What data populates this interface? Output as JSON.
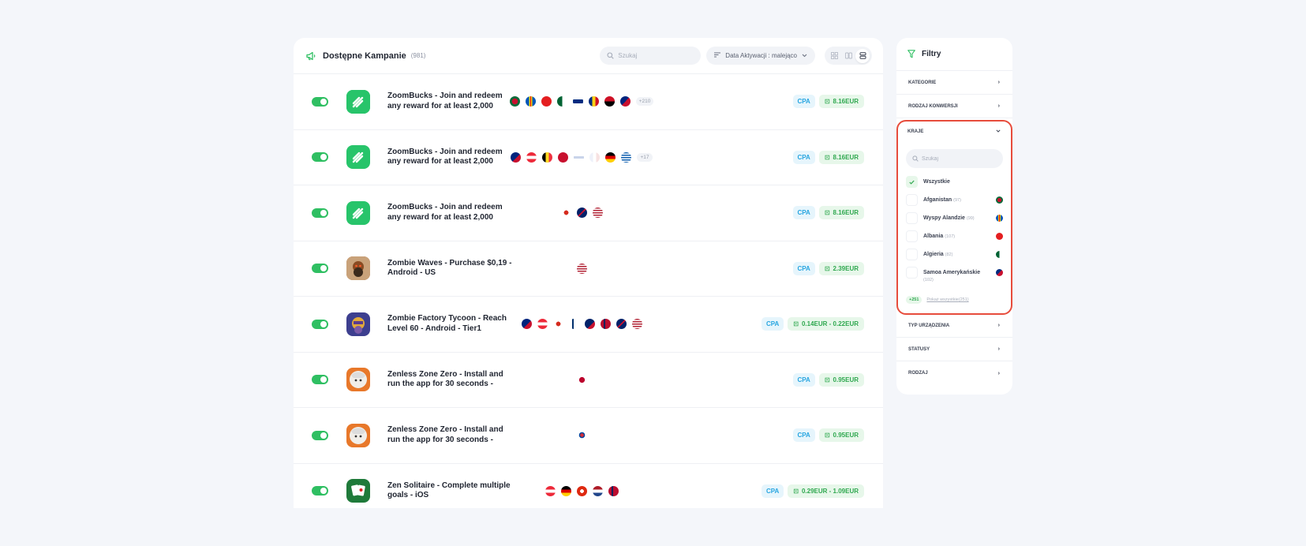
{
  "header": {
    "title": "Dostępne Kampanie",
    "count": "(981)",
    "search_placeholder": "Szukaj",
    "sort_label": "Data Aktywacji : malejąco"
  },
  "campaigns": [
    {
      "title": "ZoomBucks - Join and redeem any reward for at least 2,000",
      "more": "+210",
      "type": "CPA",
      "payout": "8.16EUR"
    },
    {
      "title": "ZoomBucks - Join and redeem any reward for at least 2,000",
      "more": "+17",
      "type": "CPA",
      "payout": "8.16EUR"
    },
    {
      "title": "ZoomBucks - Join and redeem any reward for at least 2,000",
      "more": "",
      "type": "CPA",
      "payout": "8.16EUR"
    },
    {
      "title": "Zombie Waves - Purchase $0,19 - Android - US",
      "more": "",
      "type": "CPA",
      "payout": "2.39EUR"
    },
    {
      "title": "Zombie Factory Tycoon - Reach Level 60 - Android - Tier1",
      "more": "",
      "type": "CPA",
      "payout": "0.14EUR - 0.22EUR"
    },
    {
      "title": "Zenless Zone Zero - Install and run the app for 30 seconds -",
      "more": "",
      "type": "CPA",
      "payout": "0.95EUR"
    },
    {
      "title": "Zenless Zone Zero - Install and run the app for 30 seconds -",
      "more": "",
      "type": "CPA",
      "payout": "0.95EUR"
    },
    {
      "title": "Zen Solitaire - Complete multiple goals - iOS",
      "more": "",
      "type": "CPA",
      "payout": "0.29EUR - 1.09EUR"
    }
  ],
  "filters": {
    "title": "Filtry",
    "sections": {
      "kategorie": "KATEGORIE",
      "rodzaj_konwersji": "RODZAJ KONWERSJI",
      "kraje": "KRAJE",
      "typ_urzadzenia": "TYP URZĄDZENIA",
      "statusy": "STATUSY",
      "rodzaj": "RODZAJ"
    },
    "kraje_search_placeholder": "Szukaj",
    "countries": [
      {
        "name": "Wszystkie",
        "count": "",
        "checked": true
      },
      {
        "name": "Afganistan",
        "count": "(97)",
        "checked": false
      },
      {
        "name": "Wyspy Alandzie",
        "count": "(99)",
        "checked": false
      },
      {
        "name": "Albania",
        "count": "(107)",
        "checked": false
      },
      {
        "name": "Algieria",
        "count": "(82)",
        "checked": false
      },
      {
        "name": "Samoa Amerykańskie",
        "count": "(102)",
        "checked": false
      }
    ],
    "more_badge": "+251",
    "show_all_label": "Pokaż wszystkie",
    "show_all_count": "(251)"
  },
  "colors": {
    "accent_green": "#2fbf62",
    "cpa_blue": "#27a5e0",
    "highlight_red": "#e74c3c"
  }
}
